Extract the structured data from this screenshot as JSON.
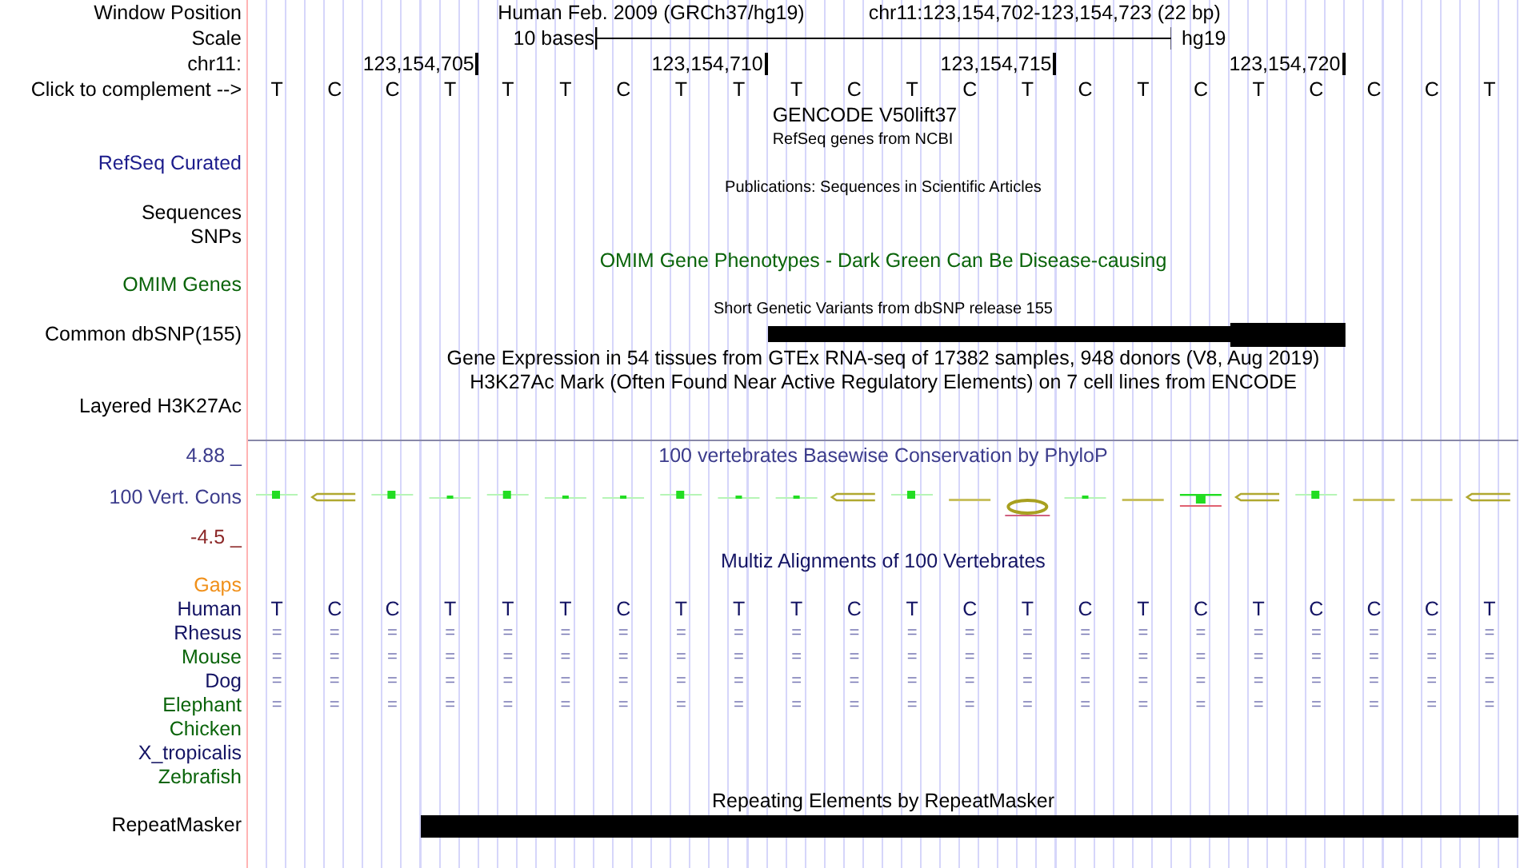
{
  "rows": [
    {
      "kind": "position",
      "label": "Window Position",
      "assembly": "Human Feb. 2009 (GRCh37/hg19)",
      "range": "chr11:123,154,702-123,154,723 (22 bp)"
    },
    {
      "kind": "scale",
      "label": "Scale",
      "span": "10 bases",
      "assembly": "hg19"
    },
    {
      "kind": "coordinates",
      "label": "chr11:",
      "ticks": [
        "123,154,705",
        "123,154,710",
        "123,154,715",
        "123,154,720"
      ]
    },
    {
      "kind": "sequence",
      "label": "Click to complement -->",
      "bases": [
        "T",
        "C",
        "C",
        "T",
        "T",
        "T",
        "C",
        "T",
        "T",
        "T",
        "C",
        "T",
        "C",
        "T",
        "C",
        "T",
        "C",
        "T",
        "C",
        "C",
        "C",
        "T"
      ]
    },
    {
      "kind": "gene-caption",
      "text": "GENCODE V50lift37"
    },
    {
      "kind": "gene-note",
      "text": "RefSeq genes from NCBI"
    },
    {
      "kind": "label",
      "label": "RefSeq Curated",
      "color": "#1c1c8c"
    },
    {
      "kind": "note",
      "text": "Publications: Sequences in Scientific Articles"
    },
    {
      "kind": "label",
      "label": "Sequences"
    },
    {
      "kind": "label",
      "label": "SNPs"
    },
    {
      "kind": "caption",
      "text": "OMIM Gene Phenotypes - Dark Green Can Be Disease-causing",
      "color": "#0a640a"
    },
    {
      "kind": "label",
      "label": "OMIM Genes",
      "color": "#0a640a"
    },
    {
      "kind": "note",
      "text": "Short Genetic Variants from dbSNP release 155"
    },
    {
      "kind": "variant-bar",
      "label": "Common dbSNP(155)"
    },
    {
      "kind": "caption",
      "text": "Gene Expression in 54 tissues from GTEx RNA-seq of 17382 samples, 948 donors (V8, Aug 2019)"
    },
    {
      "kind": "caption",
      "text": "H3K27Ac Mark (Often Found Near Active Regulatory Elements) on 7 cell lines from ENCODE"
    },
    {
      "kind": "label",
      "label": "Layered H3K27Ac"
    },
    {
      "kind": "divider"
    },
    {
      "kind": "graph-max",
      "label": "4.88 _",
      "text": "100 vertebrates Basewise Conservation by PhyloP",
      "color": "#3c3c8c"
    },
    {
      "kind": "graph",
      "label": "100 Vert. Cons",
      "color": "#3c3c8c"
    },
    {
      "kind": "graph-min",
      "label": "-4.5 _",
      "color": "#8c2828"
    },
    {
      "kind": "caption",
      "text": "Multiz Alignments of 100 Vertebrates",
      "color": "#141464"
    },
    {
      "kind": "label",
      "label": "Gaps",
      "color": "#f0901a"
    },
    {
      "kind": "bases",
      "label": "Human",
      "color": "#141464",
      "bases": [
        "T",
        "C",
        "C",
        "T",
        "T",
        "T",
        "C",
        "T",
        "T",
        "T",
        "C",
        "T",
        "C",
        "T",
        "C",
        "T",
        "C",
        "T",
        "C",
        "C",
        "C",
        "T"
      ]
    },
    {
      "kind": "matches",
      "label": "Rhesus",
      "color": "#141464",
      "marks": [
        "=",
        "=",
        "=",
        "=",
        "=",
        "=",
        "=",
        "=",
        "=",
        "=",
        "=",
        "=",
        "=",
        "=",
        "=",
        "=",
        "=",
        "=",
        "=",
        "=",
        "=",
        "="
      ]
    },
    {
      "kind": "matches",
      "label": "Mouse",
      "color": "#0a640a",
      "marks": [
        "=",
        "=",
        "=",
        "=",
        "=",
        "=",
        "=",
        "=",
        "=",
        "=",
        "=",
        "=",
        "=",
        "=",
        "=",
        "=",
        "=",
        "=",
        "=",
        "=",
        "=",
        "="
      ]
    },
    {
      "kind": "matches",
      "label": "Dog",
      "color": "#141464",
      "marks": [
        "=",
        "=",
        "=",
        "=",
        "=",
        "=",
        "=",
        "=",
        "=",
        "=",
        "=",
        "=",
        "=",
        "=",
        "=",
        "=",
        "=",
        "=",
        "=",
        "=",
        "=",
        "="
      ]
    },
    {
      "kind": "matches",
      "label": "Elephant",
      "color": "#0a640a",
      "marks": [
        "=",
        "=",
        "=",
        "=",
        "=",
        "=",
        "=",
        "=",
        "=",
        "=",
        "=",
        "=",
        "=",
        "=",
        "=",
        "=",
        "=",
        "=",
        "=",
        "=",
        "=",
        "="
      ]
    },
    {
      "kind": "label",
      "label": "Chicken",
      "color": "#0a640a"
    },
    {
      "kind": "label",
      "label": "X_tropicalis",
      "color": "#141464"
    },
    {
      "kind": "label",
      "label": "Zebrafish",
      "color": "#0a640a"
    },
    {
      "kind": "caption",
      "text": "Repeating Elements by RepeatMasker"
    },
    {
      "kind": "repeat-bar",
      "label": "RepeatMasker"
    }
  ]
}
